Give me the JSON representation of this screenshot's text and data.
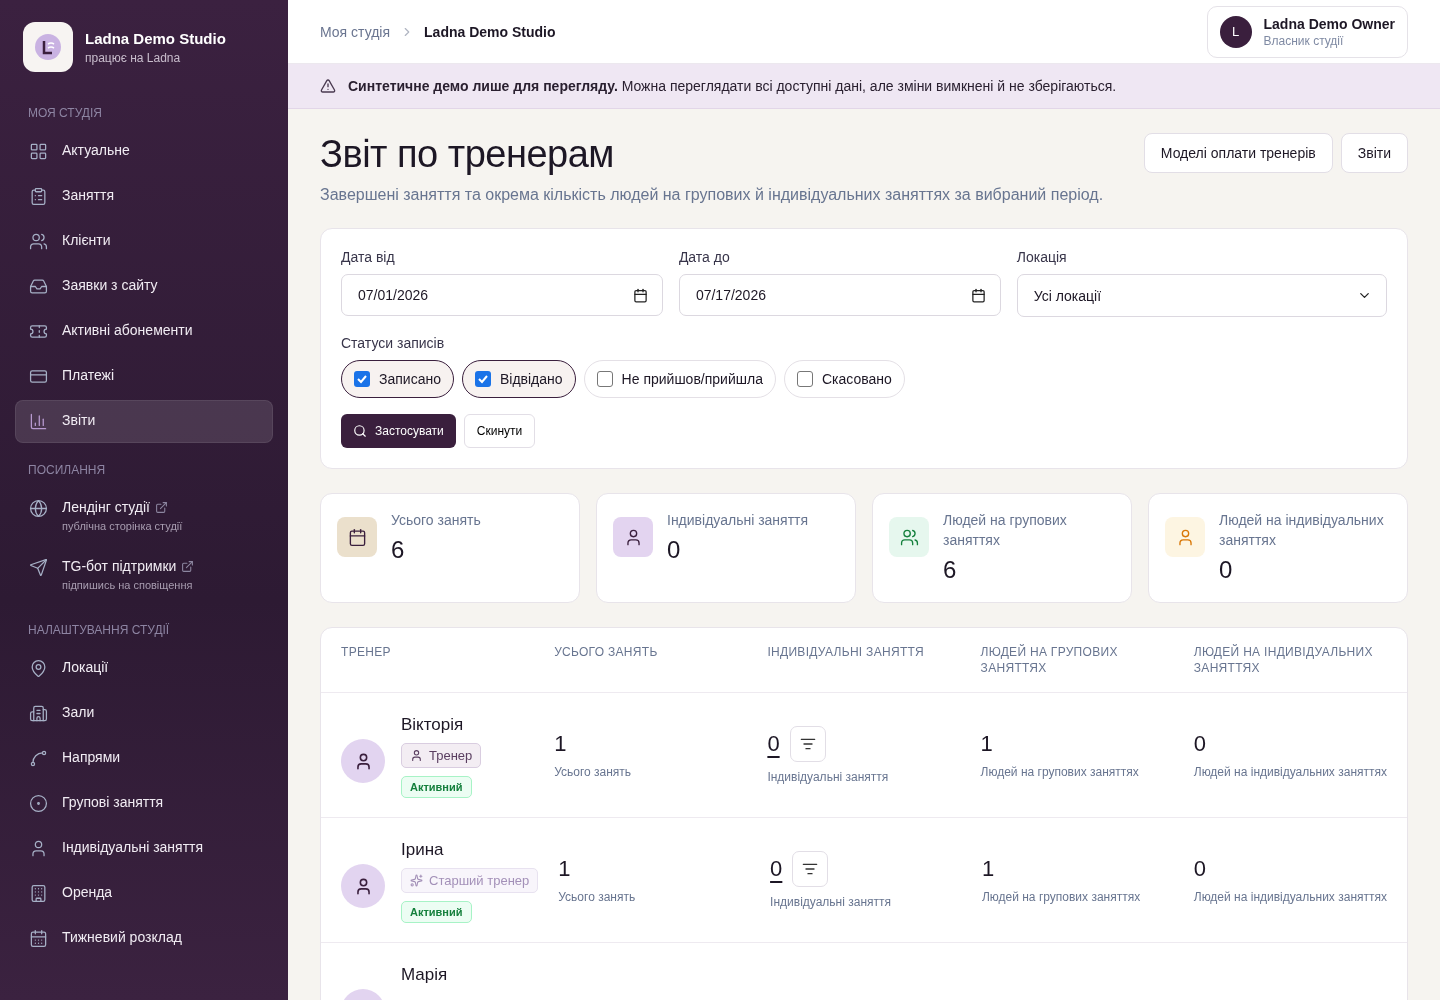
{
  "sidebar": {
    "brand": {
      "name": "Ladna Demo Studio",
      "tagline": "працює на Ladna"
    },
    "sections": [
      {
        "title": "МОЯ СТУДІЯ",
        "items": [
          {
            "label": "Актуальне",
            "selected": false
          },
          {
            "label": "Заняття",
            "selected": false
          },
          {
            "label": "Клієнти",
            "selected": false
          },
          {
            "label": "Заявки з сайту",
            "selected": false
          },
          {
            "label": "Активні абонементи",
            "selected": false
          },
          {
            "label": "Платежі",
            "selected": false
          },
          {
            "label": "Звіти",
            "selected": true
          }
        ]
      },
      {
        "title": "ПОСИЛАННЯ",
        "items": [
          {
            "label": "Лендінг студії",
            "sublabel": "публічна сторінка студії",
            "selected": false
          },
          {
            "label": "TG-бот підтримки",
            "sublabel": "підпишись на сповіщення",
            "selected": false
          }
        ]
      },
      {
        "title": "НАЛАШТУВАННЯ СТУДІЇ",
        "items": [
          {
            "label": "Локації",
            "selected": false
          },
          {
            "label": "Зали",
            "selected": false
          },
          {
            "label": "Напрями",
            "selected": false
          },
          {
            "label": "Групові заняття",
            "selected": false
          },
          {
            "label": "Індивідуальні заняття",
            "selected": false
          },
          {
            "label": "Оренда",
            "selected": false
          },
          {
            "label": "Тижневий розклад",
            "selected": false
          }
        ]
      }
    ]
  },
  "breadcrumbs": [
    "Моя студія",
    "Ladna Demo Studio"
  ],
  "user": {
    "initial": "L",
    "name": "Ladna Demo Owner",
    "role": "Власник студії"
  },
  "banner": "**Синтетичне демо лише для перегляду.** Можна переглядати всі доступні дані, але зміни вимкнені й не зберігаються.",
  "page": {
    "title": "Звіт по тренерам",
    "subtitle": "Завершені заняття та окрема кількість людей на групових й індивідуальних заняттях за вибраний період.",
    "actions": [
      "Моделі оплати тренерів",
      "Звіти"
    ]
  },
  "filters": {
    "date_from": {
      "label": "Дата від",
      "value": "07/01/2026"
    },
    "date_to": {
      "label": "Дата до",
      "value": "07/17/2026"
    },
    "location": {
      "label": "Локація",
      "value": "Усі локації"
    },
    "statuses_label": "Статуси записів",
    "statuses": [
      {
        "label": "Записано",
        "checked": true
      },
      {
        "label": "Відвідано",
        "checked": true
      },
      {
        "label": "Не прийшов/прийшла",
        "checked": false
      },
      {
        "label": "Скасовано",
        "checked": false
      }
    ],
    "apply": "Застосувати",
    "reset": "Скинути"
  },
  "stats": [
    {
      "kind": "calendar",
      "label": "Усього занять",
      "value": "6",
      "color": "#ebe0cc"
    },
    {
      "kind": "user",
      "label": "Індивідуальні заняття",
      "value": "0",
      "color": "#e3d4f0"
    },
    {
      "kind": "users",
      "label": "Людей на групових заняттях",
      "value": "6",
      "color": "#e6f7ee"
    },
    {
      "kind": "user",
      "label": "Людей на індивідуальних заняттях",
      "value": "0",
      "color": "#fdf5e2"
    }
  ],
  "table": {
    "columns": [
      "ТРЕНЕР",
      "УСЬОГО ЗАНЯТЬ",
      "ІНДИВІДУАЛЬНІ ЗАНЯТТЯ",
      "ЛЮДЕЙ НА ГРУПОВИХ ЗАНЯТТЯХ",
      "ЛЮДЕЙ НА ІНДИВІДУАЛЬНИХ ЗАНЯТТЯХ"
    ],
    "rows": [
      {
        "name": "Вікторія",
        "role": {
          "kind": "trainer",
          "label": "Тренер"
        },
        "status": "Активний",
        "total": "1",
        "total_label": "Усього занять",
        "individual": "0",
        "individual_label": "Індивідуальні заняття",
        "group_people": "1",
        "group_people_label": "Людей на групових заняттях",
        "individual_people": "0",
        "individual_people_label": "Людей на індивідуальних заняттях"
      },
      {
        "name": "Ірина",
        "role": {
          "kind": "senior",
          "label": "Старший тренер"
        },
        "status": "Активний",
        "total": "1",
        "total_label": "Усього занять",
        "individual": "0",
        "individual_label": "Індивідуальні заняття",
        "group_people": "1",
        "group_people_label": "Людей на групових заняттях",
        "individual_people": "0",
        "individual_people_label": "Людей на індивідуальних заняттях"
      },
      {
        "name": "Марія"
      }
    ]
  }
}
